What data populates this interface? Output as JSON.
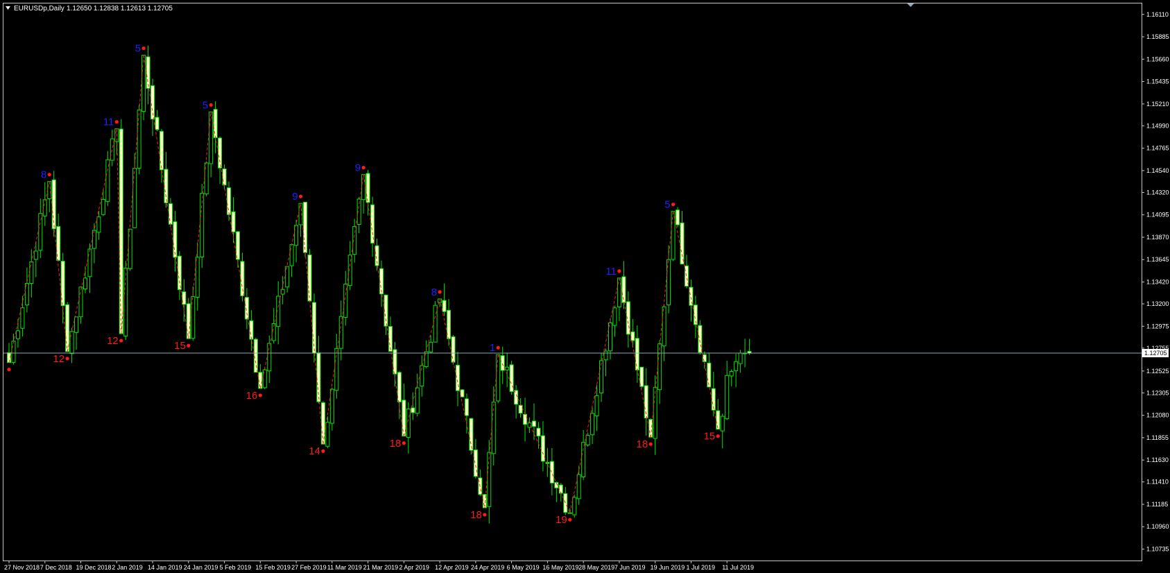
{
  "header": {
    "symbol": "EURUSDp,Daily",
    "ohlc": "1.12650 1.12838 1.12613 1.12705"
  },
  "colors": {
    "background": "#000000",
    "frame": "#c8c8c8",
    "candle_bull_fill": "#000000",
    "candle_bear_fill": "#ffffc8",
    "candle_outline": "#00e600",
    "zigzag": "#ff1a1a",
    "peak_label": "#2020ff",
    "trough_label": "#ff1a1a",
    "bid_line": "#8fa7b8",
    "axis_text": "#ffffff"
  },
  "icons": {
    "dropdown": "triangle-down-icon",
    "shift_marker": "triangle-down-icon"
  },
  "chart_data": {
    "type": "candlestick",
    "title": "EURUSDp,Daily",
    "ylim": [
      1.1062,
      1.1622
    ],
    "y_ticks": [
      "1.16110",
      "1.15885",
      "1.15660",
      "1.15435",
      "1.15210",
      "1.14990",
      "1.14765",
      "1.14540",
      "1.14320",
      "1.14095",
      "1.13870",
      "1.13645",
      "1.13420",
      "1.13200",
      "1.12975",
      "1.12755",
      "1.12525",
      "1.12305",
      "1.12080",
      "1.11855",
      "1.11630",
      "1.11410",
      "1.11185",
      "1.10960",
      "1.10735"
    ],
    "x_ticks": [
      "27 Nov 2018",
      "7 Dec 2018",
      "19 Dec 2018",
      "2 Jan 2019",
      "14 Jan 2019",
      "24 Jan 2019",
      "5 Feb 2019",
      "15 Feb 2019",
      "27 Feb 2019",
      "11 Mar 2019",
      "21 Mar 2019",
      "2 Apr 2019",
      "12 Apr 2019",
      "24 Apr 2019",
      "6 May 2019",
      "16 May 2019",
      "28 May 2019",
      "7 Jun 2019",
      "19 Jun 2019",
      "1 Jul 2019",
      "11 Jul 2019"
    ],
    "x_tick_index": [
      0,
      8,
      16,
      24,
      32,
      40,
      48,
      56,
      64,
      72,
      80,
      88,
      96,
      104,
      112,
      120,
      128,
      136,
      144,
      152,
      160
    ],
    "current_price": "1.12705",
    "candles": [],
    "zigzag": [
      {
        "i": 0,
        "price": 1.1261
      },
      {
        "i": 9,
        "price": 1.1443
      },
      {
        "i": 13,
        "price": 1.1272
      },
      {
        "i": 24,
        "price": 1.1496
      },
      {
        "i": 25,
        "price": 1.129
      },
      {
        "i": 30,
        "price": 1.157
      },
      {
        "i": 40,
        "price": 1.1285
      },
      {
        "i": 45,
        "price": 1.1513
      },
      {
        "i": 56,
        "price": 1.1235
      },
      {
        "i": 65,
        "price": 1.1421
      },
      {
        "i": 70,
        "price": 1.1179
      },
      {
        "i": 79,
        "price": 1.145
      },
      {
        "i": 88,
        "price": 1.1187
      },
      {
        "i": 96,
        "price": 1.1325
      },
      {
        "i": 106,
        "price": 1.1115
      },
      {
        "i": 109,
        "price": 1.1269
      },
      {
        "i": 125,
        "price": 1.111
      },
      {
        "i": 136,
        "price": 1.1346
      },
      {
        "i": 143,
        "price": 1.1186
      },
      {
        "i": 148,
        "price": 1.1413
      },
      {
        "i": 158,
        "price": 1.1194
      }
    ],
    "labels": [
      {
        "i": 0,
        "price": 1.1261,
        "text": "",
        "kind": "low"
      },
      {
        "i": 9,
        "price": 1.1443,
        "text": "8",
        "kind": "high"
      },
      {
        "i": 13,
        "price": 1.1272,
        "text": "12",
        "kind": "low"
      },
      {
        "i": 24,
        "price": 1.1496,
        "text": "11",
        "kind": "high"
      },
      {
        "i": 25,
        "price": 1.129,
        "text": "12",
        "kind": "low"
      },
      {
        "i": 30,
        "price": 1.157,
        "text": "5",
        "kind": "high"
      },
      {
        "i": 40,
        "price": 1.1285,
        "text": "15",
        "kind": "low"
      },
      {
        "i": 45,
        "price": 1.1513,
        "text": "5",
        "kind": "high"
      },
      {
        "i": 56,
        "price": 1.1235,
        "text": "16",
        "kind": "low"
      },
      {
        "i": 65,
        "price": 1.1421,
        "text": "9",
        "kind": "high"
      },
      {
        "i": 70,
        "price": 1.1179,
        "text": "14",
        "kind": "low"
      },
      {
        "i": 79,
        "price": 1.145,
        "text": "9",
        "kind": "high"
      },
      {
        "i": 88,
        "price": 1.1187,
        "text": "18",
        "kind": "low"
      },
      {
        "i": 96,
        "price": 1.1325,
        "text": "8",
        "kind": "high"
      },
      {
        "i": 106,
        "price": 1.1115,
        "text": "18",
        "kind": "low"
      },
      {
        "i": 109,
        "price": 1.1269,
        "text": "1",
        "kind": "high"
      },
      {
        "i": 125,
        "price": 1.111,
        "text": "19",
        "kind": "low"
      },
      {
        "i": 136,
        "price": 1.1346,
        "text": "11",
        "kind": "high"
      },
      {
        "i": 143,
        "price": 1.1186,
        "text": "18",
        "kind": "low"
      },
      {
        "i": 148,
        "price": 1.1413,
        "text": "5",
        "kind": "high"
      },
      {
        "i": 158,
        "price": 1.1194,
        "text": "15",
        "kind": "low"
      }
    ]
  }
}
